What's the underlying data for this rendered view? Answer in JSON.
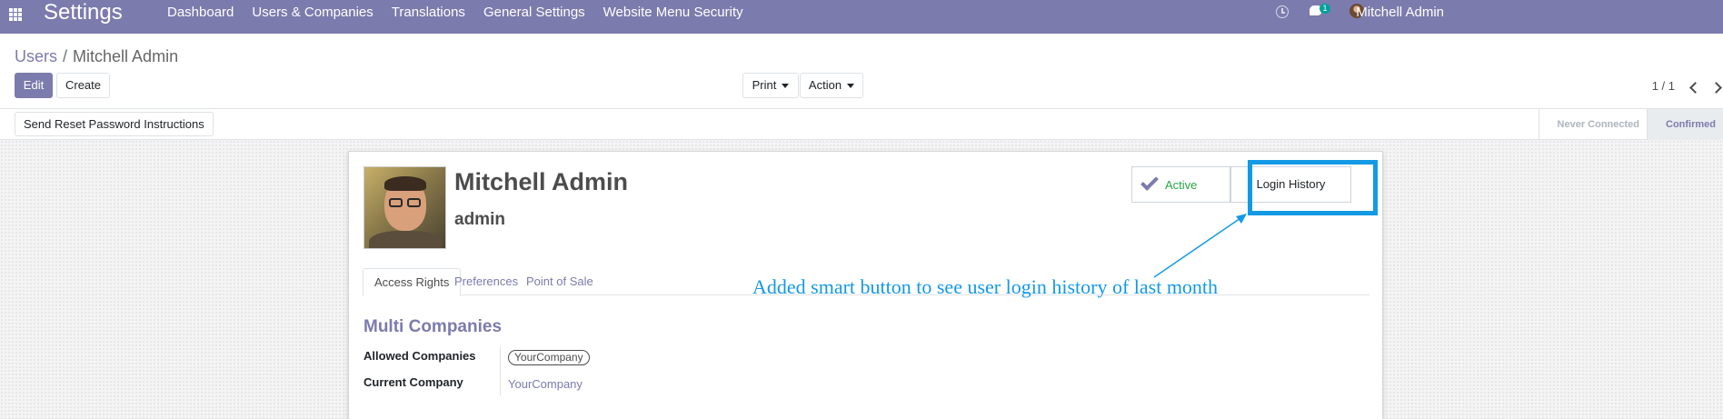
{
  "navbar": {
    "app_title": "Settings",
    "menu": [
      "Dashboard",
      "Users & Companies",
      "Translations",
      "General Settings",
      "Website Menu Security"
    ],
    "chat_badge": "1",
    "user_name": "Mitchell Admin",
    "bg_color": "#7c7bad"
  },
  "breadcrumb": {
    "parent": "Users",
    "separator": "/",
    "current": "Mitchell Admin"
  },
  "buttons": {
    "edit": "Edit",
    "create": "Create",
    "print": "Print",
    "action": "Action"
  },
  "pager": {
    "value": "1 / 1"
  },
  "statusbar": {
    "reset_password": "Send Reset Password Instructions",
    "stages": [
      "Never Connected",
      "Confirmed"
    ],
    "current_stage": "Confirmed"
  },
  "user": {
    "name": "Mitchell Admin",
    "login": "admin"
  },
  "smart_buttons": {
    "active": "Active",
    "login_history": "Login History"
  },
  "tabs": [
    "Access Rights",
    "Preferences",
    "Point of Sale"
  ],
  "access_rights": {
    "section_title": "Multi Companies",
    "allowed_companies_label": "Allowed Companies",
    "allowed_companies": [
      "YourCompany"
    ],
    "current_company_label": "Current Company",
    "current_company": "YourCompany"
  },
  "annotation": {
    "text": "Added smart button to see user login history of last month",
    "color": "#1499e5"
  },
  "icons": [
    "apps-grid-icon",
    "clock-icon",
    "chat-icon",
    "avatar",
    "chevron-left-icon",
    "chevron-right-icon",
    "check-icon"
  ]
}
